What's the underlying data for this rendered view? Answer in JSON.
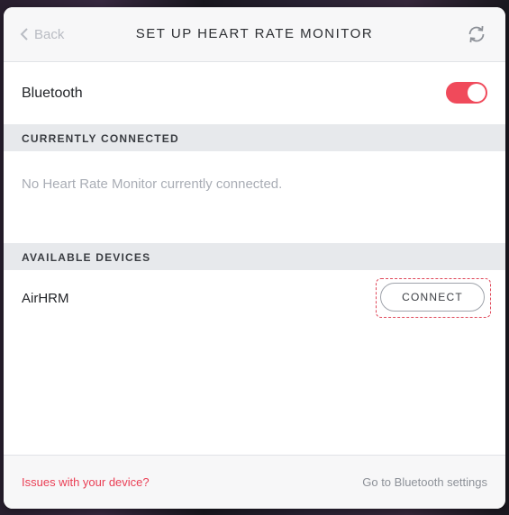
{
  "header": {
    "back_label": "Back",
    "title": "SET UP HEART RATE MONITOR",
    "refresh_icon": "refresh-icon"
  },
  "bluetooth": {
    "label": "Bluetooth",
    "enabled": true,
    "toggle_color": "#f04a5b"
  },
  "connected": {
    "header": "CURRENTLY CONNECTED",
    "empty_message": "No Heart Rate Monitor currently connected."
  },
  "available": {
    "header": "AVAILABLE DEVICES",
    "devices": [
      {
        "name": "AirHRM",
        "action_label": "CONNECT"
      }
    ]
  },
  "footer": {
    "issues_link": "Issues with your device?",
    "settings_link": "Go to Bluetooth settings",
    "issues_color": "#ea3f55"
  }
}
